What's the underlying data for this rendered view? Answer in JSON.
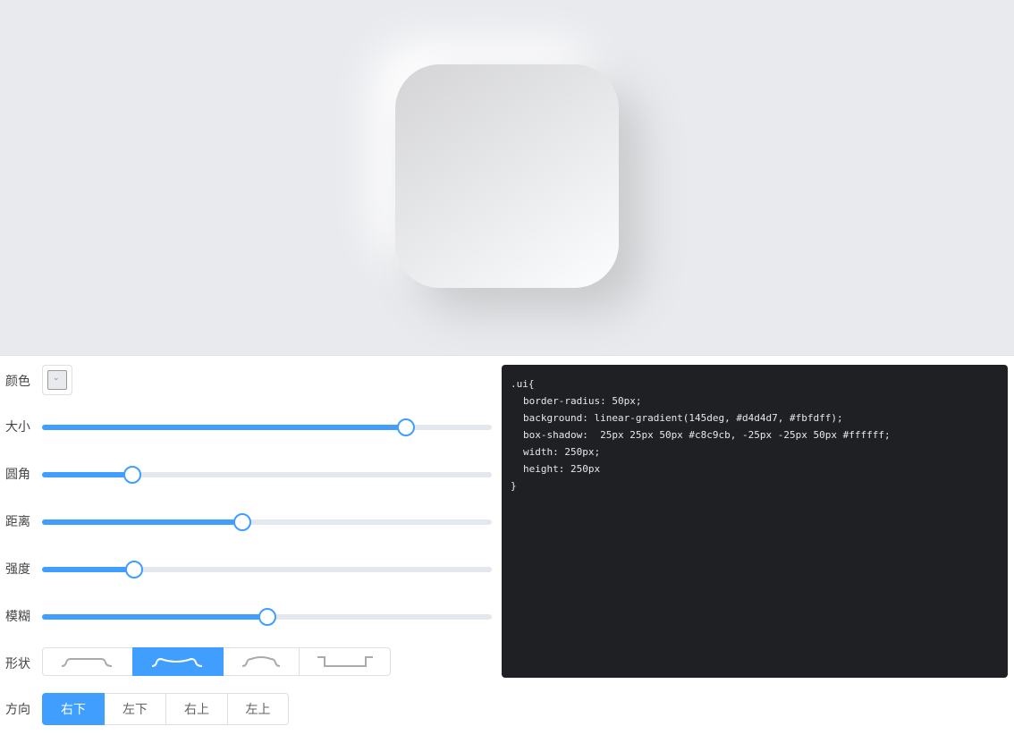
{
  "preview": {
    "box_gradient_start": "#d4d4d7",
    "box_gradient_end": "#fbfdff",
    "background": "#e9eaee"
  },
  "controls": {
    "color": {
      "label": "颜色",
      "value": "#e9eaee"
    },
    "sliders": [
      {
        "label": "大小",
        "fraction": 0.81
      },
      {
        "label": "圆角",
        "fraction": 0.2
      },
      {
        "label": "距离",
        "fraction": 0.445
      },
      {
        "label": "强度",
        "fraction": 0.204
      },
      {
        "label": "模糊",
        "fraction": 0.5
      }
    ],
    "shape": {
      "label": "形状",
      "options": [
        "flat",
        "concave",
        "convex",
        "pressed"
      ],
      "selected": "concave"
    },
    "direction": {
      "label": "方向",
      "options": [
        "右下",
        "左下",
        "右上",
        "左上"
      ],
      "selected": "右下"
    }
  },
  "accent_color": "#409eff",
  "code": {
    "lines": [
      ".ui{",
      "border-radius: 50px;",
      "background: linear-gradient(145deg, #d4d4d7, #fbfdff);",
      "box-shadow:  25px 25px 50px #c8c9cb, -25px -25px 50px #ffffff;",
      "width: 250px;",
      "height: 250px",
      "}"
    ]
  }
}
